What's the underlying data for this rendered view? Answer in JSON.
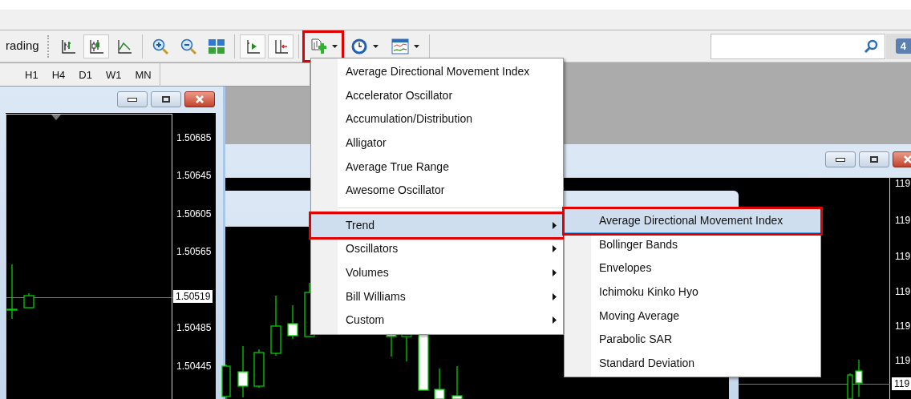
{
  "toolbar": {
    "label": "rading",
    "groups": [
      [
        {
          "kind": "bar-chart",
          "pressed": false,
          "annotated": false
        },
        {
          "kind": "candles",
          "pressed": true,
          "annotated": false
        },
        {
          "kind": "line-chart",
          "pressed": false,
          "annotated": false
        }
      ],
      [
        {
          "kind": "zoom-in",
          "pressed": false,
          "annotated": false
        },
        {
          "kind": "zoom-out",
          "pressed": false,
          "annotated": false
        },
        {
          "kind": "tile",
          "pressed": false,
          "annotated": false
        }
      ],
      [
        {
          "kind": "autoscroll",
          "pressed": true,
          "annotated": false
        },
        {
          "kind": "shift",
          "pressed": true,
          "annotated": false
        }
      ],
      [
        {
          "kind": "indicators",
          "pressed": false,
          "annotated": true
        },
        {
          "kind": "clock",
          "pressed": false,
          "annotated": false
        },
        {
          "kind": "template",
          "pressed": false,
          "annotated": false
        }
      ]
    ]
  },
  "notification_badge": "4",
  "timeframes": [
    "H1",
    "H4",
    "D1",
    "W1",
    "MN"
  ],
  "left_chart": {
    "price_labels": [
      "1.50685",
      "1.50645",
      "1.50605",
      "1.50565",
      "1.50485",
      "1.50445"
    ],
    "current_price": "1.50519"
  },
  "right_chart": {
    "price_labels": [
      "119",
      "119",
      "119",
      "119",
      "119",
      "119"
    ],
    "current_price": "119"
  },
  "menu": [
    {
      "kind": "item",
      "label": "Average Directional Movement Index",
      "selected": false,
      "annotated": false
    },
    {
      "kind": "item",
      "label": "Accelerator Oscillator",
      "selected": false,
      "annotated": false
    },
    {
      "kind": "item",
      "label": "Accumulation/Distribution",
      "selected": false,
      "annotated": false
    },
    {
      "kind": "item",
      "label": "Alligator",
      "selected": false,
      "annotated": false
    },
    {
      "kind": "item",
      "label": "Average True Range",
      "selected": false,
      "annotated": false
    },
    {
      "kind": "item",
      "label": "Awesome Oscillator",
      "selected": false,
      "annotated": false
    },
    {
      "kind": "separator"
    },
    {
      "kind": "submenu",
      "label": "Trend",
      "selected": true,
      "annotated": true
    },
    {
      "kind": "submenu",
      "label": "Oscillators",
      "selected": false,
      "annotated": false
    },
    {
      "kind": "submenu",
      "label": "Volumes",
      "selected": false,
      "annotated": false
    },
    {
      "kind": "submenu",
      "label": "Bill Williams",
      "selected": false,
      "annotated": false
    },
    {
      "kind": "submenu",
      "label": "Custom",
      "selected": false,
      "annotated": false
    }
  ],
  "submenu": [
    {
      "label": "Average Directional Movement Index",
      "selected": true,
      "annotated": true
    },
    {
      "label": "Bollinger Bands",
      "selected": false,
      "annotated": false
    },
    {
      "label": "Envelopes",
      "selected": false,
      "annotated": false
    },
    {
      "label": "Ichimoku Kinko Hyo",
      "selected": false,
      "annotated": false
    },
    {
      "label": "Moving Average",
      "selected": false,
      "annotated": false
    },
    {
      "label": "Parabolic SAR",
      "selected": false,
      "annotated": false
    },
    {
      "label": "Standard Deviation",
      "selected": false,
      "annotated": false
    }
  ]
}
